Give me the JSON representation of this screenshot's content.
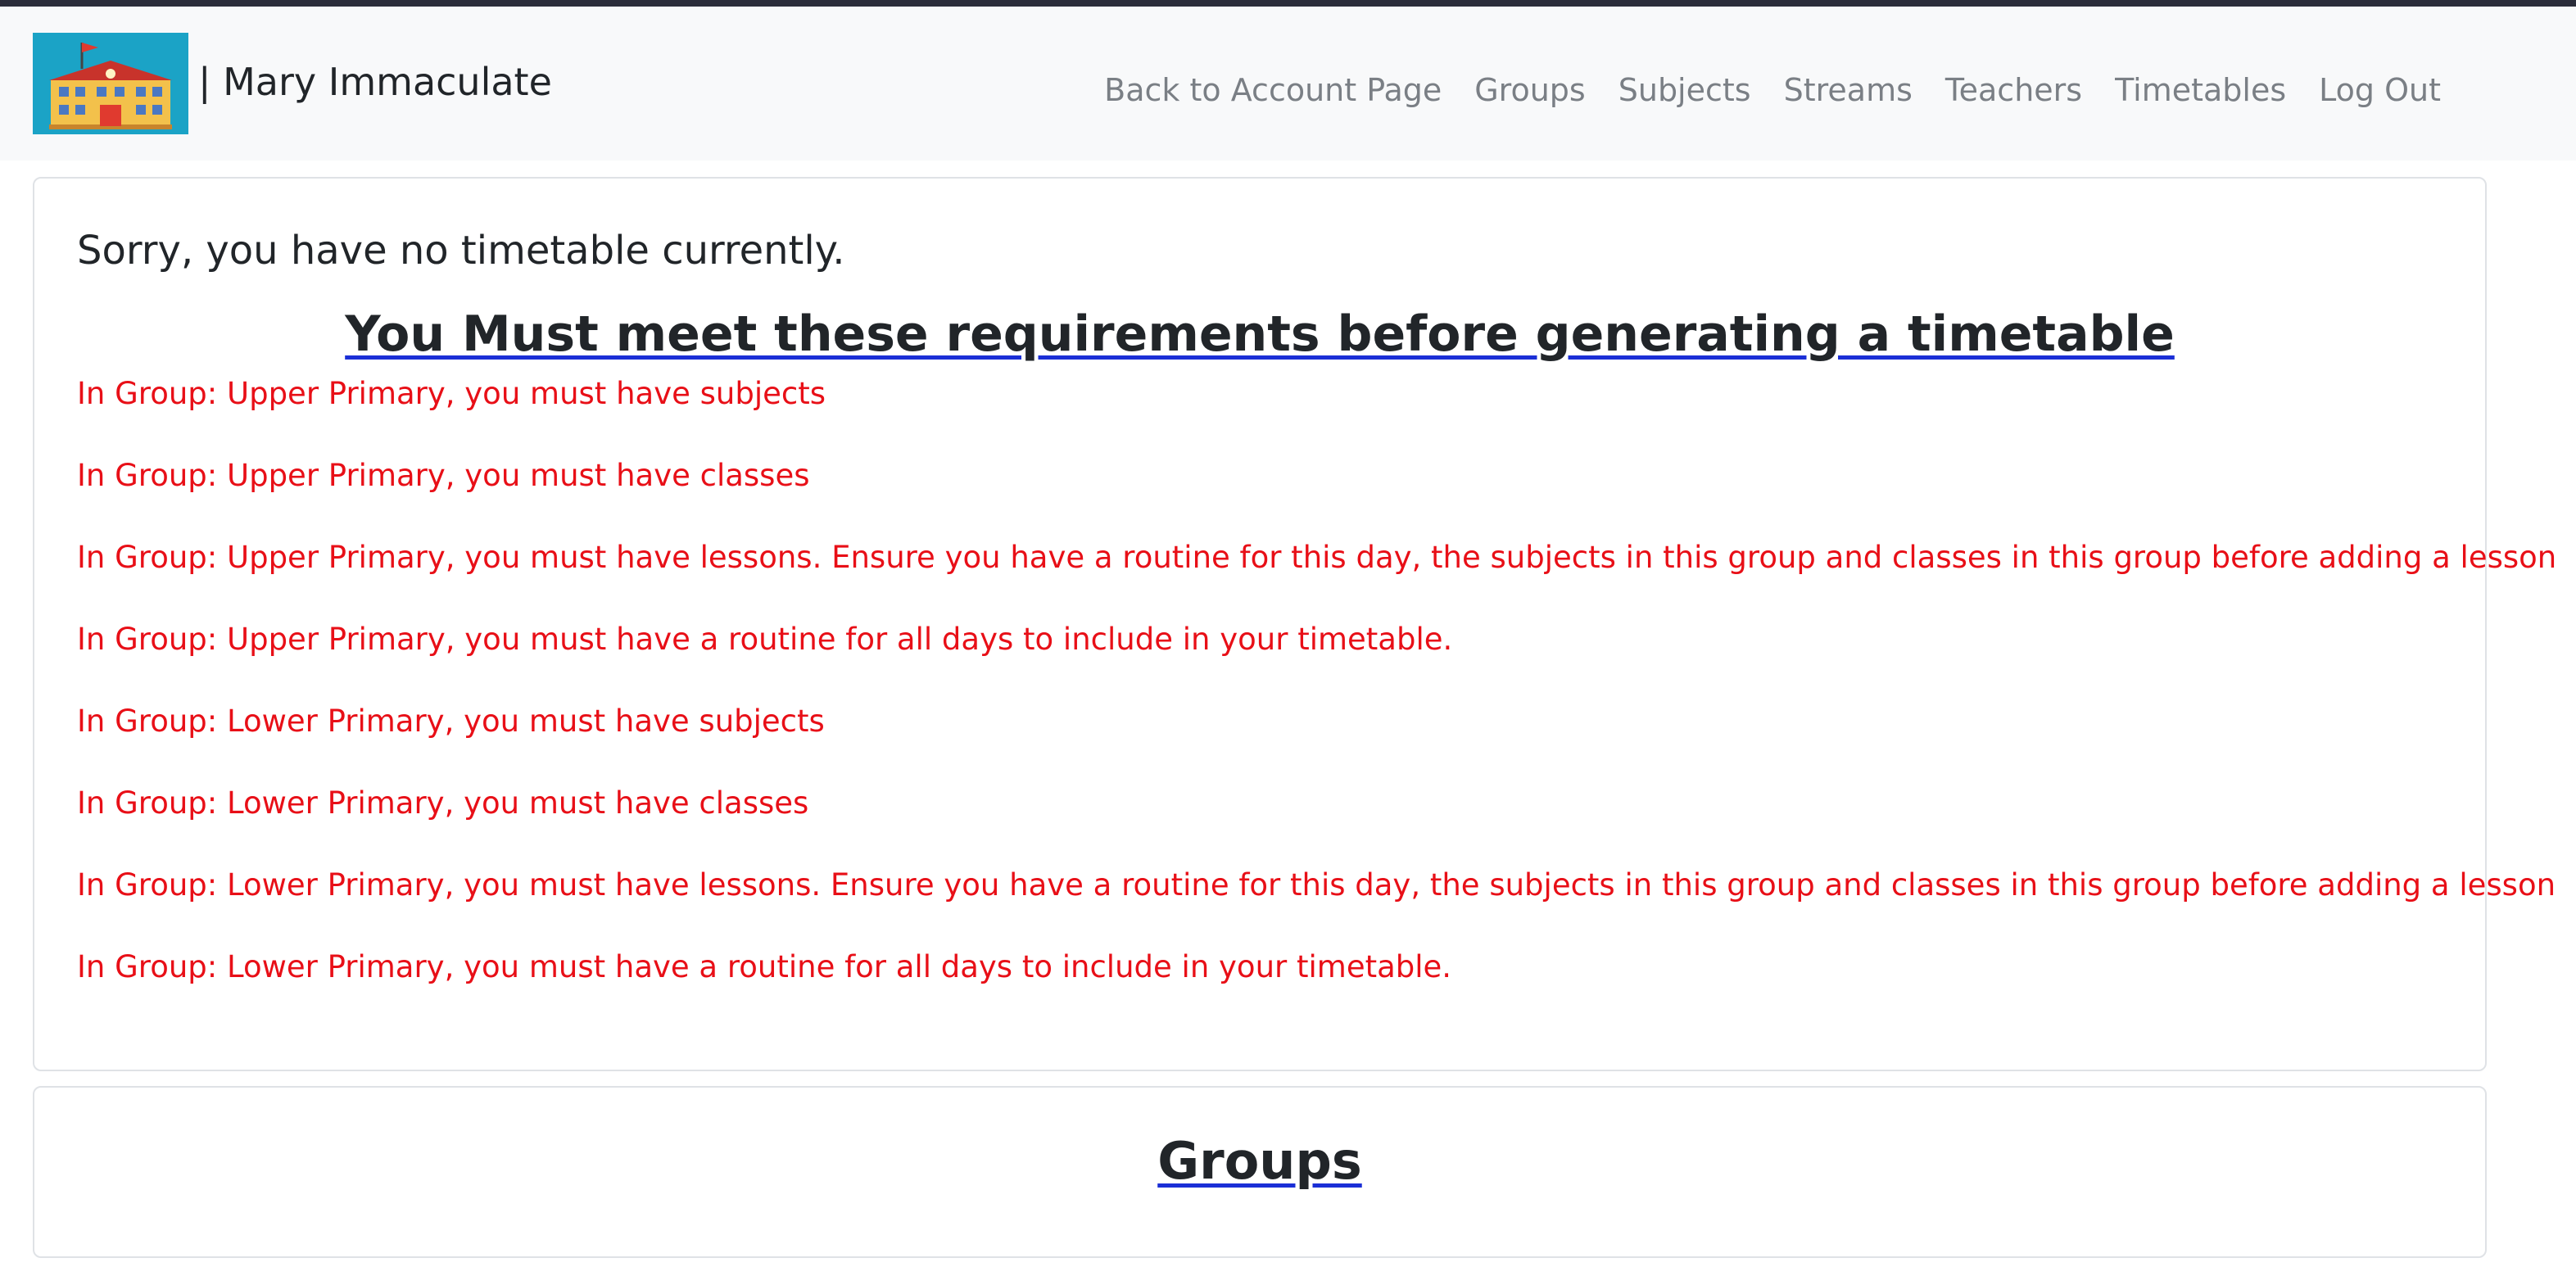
{
  "header": {
    "brand_text": "| Mary Immaculate",
    "logo_icon": "school-building-icon",
    "nav": [
      {
        "label": "Back to Account Page"
      },
      {
        "label": "Groups"
      },
      {
        "label": "Subjects"
      },
      {
        "label": "Streams"
      },
      {
        "label": "Teachers"
      },
      {
        "label": "Timetables"
      },
      {
        "label": "Log Out"
      }
    ]
  },
  "main": {
    "no_timetable_message": "Sorry, you have no timetable currently.",
    "requirements_heading": "You Must meet these requirements before generating a timetable",
    "errors": [
      "In Group: Upper Primary, you must have subjects",
      "In Group: Upper Primary, you must have classes",
      "In Group: Upper Primary, you must have lessons. Ensure you have a routine for this day, the subjects in this group and classes in this group before adding a lesson",
      "In Group: Upper Primary, you must have a routine for all days to include in your timetable.",
      "In Group: Lower Primary, you must have subjects",
      "In Group: Lower Primary, you must have classes",
      "In Group: Lower Primary, you must have lessons. Ensure you have a routine for this day, the subjects in this group and classes in this group before adding a lesson",
      "In Group: Lower Primary, you must have a routine for all days to include in your timetable."
    ],
    "groups_heading": "Groups"
  },
  "colors": {
    "error_text": "#e80f17",
    "heading_underline": "#1b2fd6",
    "navbar_bg": "#f8f9fa",
    "nav_link": "#7a7f85",
    "logo_bg": "#1ba3c6"
  }
}
